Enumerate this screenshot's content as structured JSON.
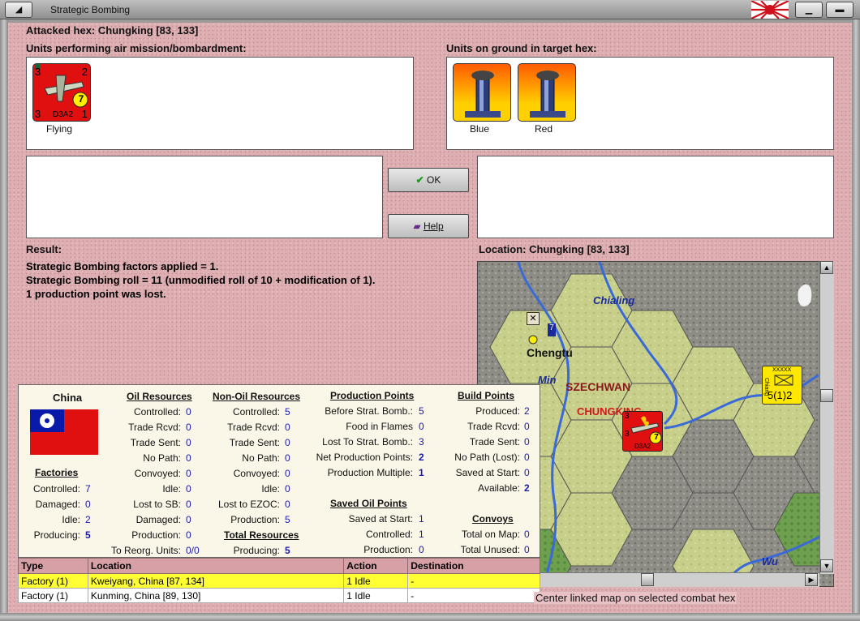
{
  "window": {
    "title": "Strategic Bombing"
  },
  "header": {
    "attacked_hex": "Attacked hex: Chungking  [83, 133]"
  },
  "air_units": {
    "heading": "Units performing air mission/bombardment:",
    "units": [
      {
        "caption": "Flying",
        "type_label": "D3A2",
        "attack": "3",
        "defense": "2",
        "range": "7",
        "bottom_left": "3",
        "bottom_right": "1",
        "color": "#e01010"
      }
    ]
  },
  "ground_units": {
    "heading": "Units on ground in target hex:",
    "units": [
      {
        "caption": "Blue"
      },
      {
        "caption": "Red"
      }
    ]
  },
  "buttons": {
    "ok_label": "OK",
    "help_label": "Help"
  },
  "result": {
    "heading": "Result:",
    "lines": [
      "Strategic Bombing factors applied = 1.",
      "Strategic Bombing roll = 11 (unmodified roll of 10 + modification of 1).",
      "1 production point was lost."
    ]
  },
  "location": {
    "heading": "Location:  Chungking  [83, 133]"
  },
  "map": {
    "labels": {
      "chialing": "Chialing",
      "chengtu": "Chengtu",
      "min": "Min",
      "szechwan": "SZECHWAN",
      "chungking": "CHUNGKING",
      "wu": "Wu"
    },
    "corps_counter": {
      "top": "XXXXX",
      "side": "Chiang",
      "value": "5(1)2"
    },
    "bomber_counter": {
      "label": "D3A2",
      "range": "7",
      "left_top": "3",
      "left_bottom": "3"
    },
    "hq_marker": "7"
  },
  "info": {
    "country": "China",
    "factories": {
      "heading": "Factories",
      "rows": [
        {
          "label": "Controlled:",
          "value": "7"
        },
        {
          "label": "Damaged:",
          "value": "0"
        },
        {
          "label": "Idle:",
          "value": "2"
        },
        {
          "label": "Producing:",
          "value": "5",
          "bold": true
        }
      ]
    },
    "oil_resources": {
      "heading": "Oil Resources",
      "rows": [
        {
          "label": "Controlled:",
          "value": "0"
        },
        {
          "label": "Trade Rcvd:",
          "value": "0"
        },
        {
          "label": "Trade Sent:",
          "value": "0"
        },
        {
          "label": "No Path:",
          "value": "0"
        },
        {
          "label": "Convoyed:",
          "value": "0"
        },
        {
          "label": "Idle:",
          "value": "0"
        },
        {
          "label": "Lost to SB:",
          "value": "0"
        },
        {
          "label": "Damaged:",
          "value": "0"
        },
        {
          "label": "Production:",
          "value": "0"
        },
        {
          "label": "To Reorg. Units:",
          "value": "0/0"
        }
      ]
    },
    "non_oil_resources": {
      "heading": "Non-Oil Resources",
      "rows": [
        {
          "label": "Controlled:",
          "value": "5"
        },
        {
          "label": "Trade Rcvd:",
          "value": "0"
        },
        {
          "label": "Trade Sent:",
          "value": "0"
        },
        {
          "label": "No Path:",
          "value": "0"
        },
        {
          "label": "Convoyed:",
          "value": "0"
        },
        {
          "label": "Idle:",
          "value": "0"
        },
        {
          "label": "Lost to EZOC:",
          "value": "0"
        },
        {
          "label": "Production:",
          "value": "5"
        }
      ]
    },
    "total_resources": {
      "heading": "Total Resources",
      "rows": [
        {
          "label": "Producing:",
          "value": "5",
          "bold": true
        }
      ]
    },
    "production_points": {
      "heading": "Production Points",
      "rows": [
        {
          "label": "Before Strat. Bomb.:",
          "value": "5"
        },
        {
          "label": "Food in Flames",
          "value": "0"
        },
        {
          "label": "Lost To Strat. Bomb.:",
          "value": "3"
        },
        {
          "label": "Net Production Points:",
          "value": "2",
          "bold": true
        },
        {
          "label": "Production Multiple:",
          "value": "1",
          "bold": true
        }
      ]
    },
    "saved_oil_points": {
      "heading": "Saved Oil Points",
      "rows": [
        {
          "label": "Saved at Start:",
          "value": "1"
        },
        {
          "label": "Controlled:",
          "value": "1"
        },
        {
          "label": "Production:",
          "value": "0"
        }
      ]
    },
    "build_points": {
      "heading": "Build Points",
      "rows": [
        {
          "label": "Produced:",
          "value": "2"
        },
        {
          "label": "Trade Rcvd:",
          "value": "0"
        },
        {
          "label": "Trade Sent:",
          "value": "0"
        },
        {
          "label": "No Path (Lost):",
          "value": "0"
        },
        {
          "label": "Saved at Start:",
          "value": "0"
        },
        {
          "label": "Available:",
          "value": "2",
          "bold": true
        }
      ]
    },
    "convoys": {
      "heading": "Convoys",
      "rows": [
        {
          "label": "Total on Map:",
          "value": "0"
        },
        {
          "label": "Total Unused:",
          "value": "0"
        }
      ]
    }
  },
  "units_table": {
    "headers": [
      "Type",
      "Location",
      "Action",
      "Destination"
    ],
    "rows": [
      {
        "type": "Factory (1)",
        "location": "Kweiyang, China [87, 134]",
        "action": "1 Idle",
        "destination": "-",
        "selected": true
      },
      {
        "type": "Factory (1)",
        "location": "Kunming, China [89, 130]",
        "action": "1 Idle",
        "destination": "-",
        "selected": false
      }
    ]
  },
  "center_map_label": "Center linked map on selected combat hex"
}
